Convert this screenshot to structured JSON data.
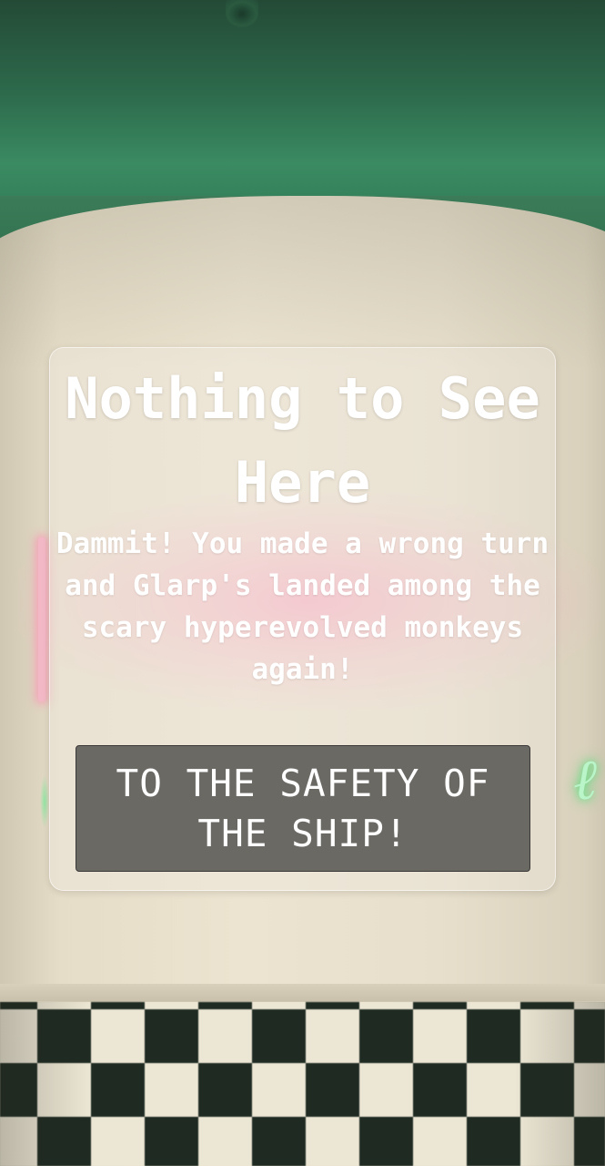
{
  "dialog": {
    "title": "Nothing to See Here",
    "message": "Dammit! You made a wrong turn and Glarp's landed among the scary hyperevolved monkeys again!",
    "button_label": "TO THE SAFETY OF THE SHIP!"
  },
  "colors": {
    "dialog_text": "#ffffff",
    "button_background": "#605e5a",
    "button_text": "#ffffff"
  }
}
